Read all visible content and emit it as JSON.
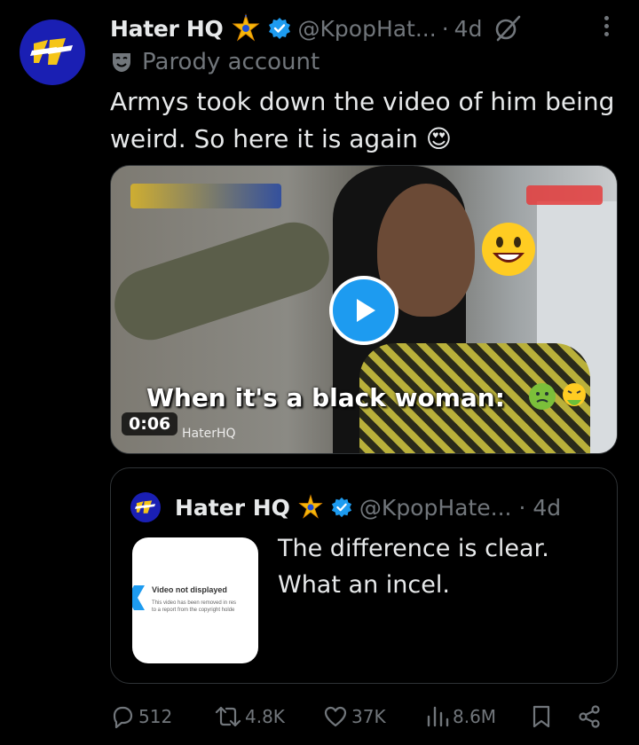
{
  "author": {
    "name": "Hater HQ",
    "handle": "@KpopHat...",
    "time_sep": "·",
    "time": "4d",
    "parody_label": "Parody account"
  },
  "tweet": {
    "text": "Armys took down the video of him being weird. So here it is again 😍"
  },
  "media": {
    "caption": "When it's a black woman:",
    "duration": "0:06",
    "watermark": "HaterHQ"
  },
  "quote": {
    "name": "Hater HQ",
    "handle": "@KpopHate...",
    "time": "· 4d",
    "text": "The difference is clear. What an incel.",
    "thumb_title": "Video not displayed",
    "thumb_body_1": "This video has been removed in res",
    "thumb_body_2": "to a report from the copyright holde"
  },
  "actions": {
    "replies": "512",
    "reposts": "4.8K",
    "likes": "37K",
    "views": "8.6M"
  },
  "colors": {
    "background": "#000000",
    "text": "#e7e9ea",
    "muted": "#71767b",
    "accent": "#1d9bf0",
    "avatar": "#1a1fb3",
    "gold": "#f5b70a"
  },
  "icons": [
    "avatar-logo-icon",
    "gold-star-icon",
    "verified-icon",
    "grok-icon",
    "more-icon",
    "parody-mask-icon",
    "play-icon",
    "reply-icon",
    "repost-icon",
    "like-icon",
    "views-icon",
    "bookmark-icon",
    "share-icon"
  ]
}
